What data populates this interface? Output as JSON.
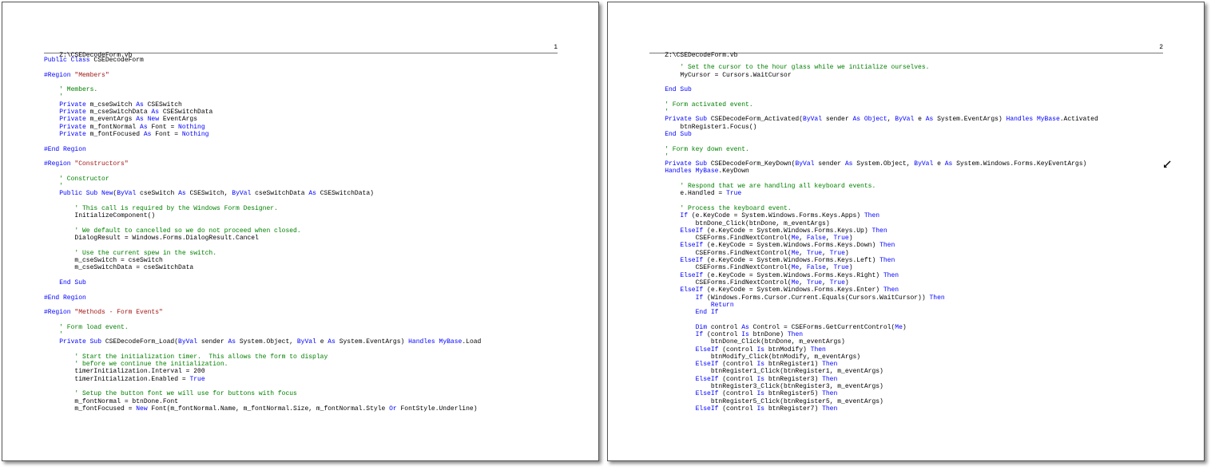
{
  "colors": {
    "keyword": "#0000ff",
    "comment": "#008000",
    "string": "#a31515",
    "text": "#000000"
  },
  "pages": [
    {
      "header_file": "Z:\\CSEDecodeForm.vb",
      "page_number": "1",
      "lines": [
        [
          [
            "k",
            "Public Class "
          ],
          [
            "t",
            "CSEDecodeForm"
          ]
        ],
        [],
        [
          [
            "k",
            "#Region "
          ],
          [
            "s",
            "\"Members\""
          ]
        ],
        [],
        [
          [
            "c",
            "    ' Members."
          ]
        ],
        [
          [
            "c",
            "    '"
          ]
        ],
        [
          [
            "k",
            "    Private "
          ],
          [
            "t",
            "m_cseSwitch "
          ],
          [
            "k",
            "As "
          ],
          [
            "t",
            "CSESwitch"
          ]
        ],
        [
          [
            "k",
            "    Private "
          ],
          [
            "t",
            "m_cseSwitchData "
          ],
          [
            "k",
            "As "
          ],
          [
            "t",
            "CSESwitchData"
          ]
        ],
        [
          [
            "k",
            "    Private "
          ],
          [
            "t",
            "m_eventArgs "
          ],
          [
            "k",
            "As New "
          ],
          [
            "t",
            "EventArgs"
          ]
        ],
        [
          [
            "k",
            "    Private "
          ],
          [
            "t",
            "m_fontNormal "
          ],
          [
            "k",
            "As "
          ],
          [
            "t",
            "Font = "
          ],
          [
            "k",
            "Nothing"
          ]
        ],
        [
          [
            "k",
            "    Private "
          ],
          [
            "t",
            "m_fontFocused "
          ],
          [
            "k",
            "As "
          ],
          [
            "t",
            "Font = "
          ],
          [
            "k",
            "Nothing"
          ]
        ],
        [],
        [
          [
            "k",
            "#End Region"
          ]
        ],
        [],
        [
          [
            "k",
            "#Region "
          ],
          [
            "s",
            "\"Constructors\""
          ]
        ],
        [],
        [
          [
            "c",
            "    ' Constructor"
          ]
        ],
        [
          [
            "c",
            "    '"
          ]
        ],
        [
          [
            "k",
            "    Public Sub New"
          ],
          [
            "t",
            "("
          ],
          [
            "k",
            "ByVal "
          ],
          [
            "t",
            "cseSwitch "
          ],
          [
            "k",
            "As "
          ],
          [
            "t",
            "CSESwitch, "
          ],
          [
            "k",
            "ByVal "
          ],
          [
            "t",
            "cseSwitchData "
          ],
          [
            "k",
            "As "
          ],
          [
            "t",
            "CSESwitchData)"
          ]
        ],
        [],
        [
          [
            "c",
            "        ' This call is required by the Windows Form Designer."
          ]
        ],
        [
          [
            "t",
            "        InitializeComponent()"
          ]
        ],
        [],
        [
          [
            "c",
            "        ' We default to cancelled so we do not proceed when closed."
          ]
        ],
        [
          [
            "t",
            "        DialogResult = Windows.Forms.DialogResult.Cancel"
          ]
        ],
        [],
        [
          [
            "c",
            "        ' Use the current spew in the switch."
          ]
        ],
        [
          [
            "t",
            "        m_cseSwitch = cseSwitch"
          ]
        ],
        [
          [
            "t",
            "        m_cseSwitchData = cseSwitchData"
          ]
        ],
        [],
        [
          [
            "k",
            "    End Sub"
          ]
        ],
        [],
        [
          [
            "k",
            "#End Region"
          ]
        ],
        [],
        [
          [
            "k",
            "#Region "
          ],
          [
            "s",
            "\"Methods - Form Events\""
          ]
        ],
        [],
        [
          [
            "c",
            "    ' Form load event."
          ]
        ],
        [
          [
            "c",
            "    '"
          ]
        ],
        [
          [
            "k",
            "    Private Sub "
          ],
          [
            "t",
            "CSEDecodeForm_Load("
          ],
          [
            "k",
            "ByVal "
          ],
          [
            "t",
            "sender "
          ],
          [
            "k",
            "As "
          ],
          [
            "t",
            "System.Object, "
          ],
          [
            "k",
            "ByVal "
          ],
          [
            "t",
            "e "
          ],
          [
            "k",
            "As "
          ],
          [
            "t",
            "System.EventArgs) "
          ],
          [
            "k",
            "Handles MyBase"
          ],
          [
            "t",
            ".Load"
          ]
        ],
        [],
        [
          [
            "c",
            "        ' Start the initialization timer.  This allows the form to display"
          ]
        ],
        [
          [
            "c",
            "        ' before we continue the initialization."
          ]
        ],
        [
          [
            "t",
            "        timerInitialization.Interval = 200"
          ]
        ],
        [
          [
            "t",
            "        timerInitialization.Enabled = "
          ],
          [
            "k",
            "True"
          ]
        ],
        [],
        [
          [
            "c",
            "        ' Setup the button font we will use for buttons with focus"
          ]
        ],
        [
          [
            "t",
            "        m_fontNormal = btnDone.Font"
          ]
        ],
        [
          [
            "t",
            "        m_fontFocused = "
          ],
          [
            "k",
            "New "
          ],
          [
            "t",
            "Font(m_fontNormal.Name, m_fontNormal.Size, m_fontNormal.Style "
          ],
          [
            "k",
            "Or "
          ],
          [
            "t",
            "FontStyle.Underline)"
          ]
        ]
      ]
    },
    {
      "header_file": "Z:\\CSEDecodeForm.vb",
      "page_number": "2",
      "lines": [
        [],
        [
          [
            "c",
            "        ' Set the cursor to the hour glass while we initialize ourselves."
          ]
        ],
        [
          [
            "t",
            "        MyCursor = Cursors.WaitCursor"
          ]
        ],
        [],
        [
          [
            "k",
            "    End Sub"
          ]
        ],
        [],
        [
          [
            "c",
            "    ' Form activated event."
          ]
        ],
        [
          [
            "c",
            "    '"
          ]
        ],
        [
          [
            "k",
            "    Private Sub "
          ],
          [
            "t",
            "CSEDecodeForm_Activated("
          ],
          [
            "k",
            "ByVal "
          ],
          [
            "t",
            "sender "
          ],
          [
            "k",
            "As Object"
          ],
          [
            "t",
            ", "
          ],
          [
            "k",
            "ByVal "
          ],
          [
            "t",
            "e "
          ],
          [
            "k",
            "As "
          ],
          [
            "t",
            "System.EventArgs) "
          ],
          [
            "k",
            "Handles MyBase"
          ],
          [
            "t",
            ".Activated"
          ]
        ],
        [
          [
            "t",
            "        btnRegister1.Focus()"
          ]
        ],
        [
          [
            "k",
            "    End Sub"
          ]
        ],
        [],
        [
          [
            "c",
            "    ' Form key down event."
          ]
        ],
        [
          [
            "c",
            "    '"
          ]
        ],
        [
          [
            "k",
            "    Private Sub "
          ],
          [
            "t",
            "CSEDecodeForm_KeyDown("
          ],
          [
            "k",
            "ByVal "
          ],
          [
            "t",
            "sender "
          ],
          [
            "k",
            "As "
          ],
          [
            "t",
            "System.Object, "
          ],
          [
            "k",
            "ByVal "
          ],
          [
            "t",
            "e "
          ],
          [
            "k",
            "As "
          ],
          [
            "t",
            "System.Windows.Forms.KeyEventArgs)"
          ]
        ],
        [
          [
            "k",
            "    Handles MyBase"
          ],
          [
            "t",
            ".KeyDown"
          ]
        ],
        [],
        [
          [
            "c",
            "        ' Respond that we are handling all keyboard events."
          ]
        ],
        [
          [
            "t",
            "        e.Handled = "
          ],
          [
            "k",
            "True"
          ]
        ],
        [],
        [
          [
            "c",
            "        ' Process the keyboard event."
          ]
        ],
        [
          [
            "k",
            "        If "
          ],
          [
            "t",
            "(e.KeyCode = System.Windows.Forms.Keys.Apps) "
          ],
          [
            "k",
            "Then"
          ]
        ],
        [
          [
            "t",
            "            btnDone_Click(btnDone, m_eventArgs)"
          ]
        ],
        [
          [
            "k",
            "        ElseIf "
          ],
          [
            "t",
            "(e.KeyCode = System.Windows.Forms.Keys.Up) "
          ],
          [
            "k",
            "Then"
          ]
        ],
        [
          [
            "t",
            "            CSEForms.FindNextControl("
          ],
          [
            "k",
            "Me"
          ],
          [
            "t",
            ", "
          ],
          [
            "k",
            "False"
          ],
          [
            "t",
            ", "
          ],
          [
            "k",
            "True"
          ],
          [
            "t",
            ")"
          ]
        ],
        [
          [
            "k",
            "        ElseIf "
          ],
          [
            "t",
            "(e.KeyCode = System.Windows.Forms.Keys.Down) "
          ],
          [
            "k",
            "Then"
          ]
        ],
        [
          [
            "t",
            "            CSEForms.FindNextControl("
          ],
          [
            "k",
            "Me"
          ],
          [
            "t",
            ", "
          ],
          [
            "k",
            "True"
          ],
          [
            "t",
            ", "
          ],
          [
            "k",
            "True"
          ],
          [
            "t",
            ")"
          ]
        ],
        [
          [
            "k",
            "        ElseIf "
          ],
          [
            "t",
            "(e.KeyCode = System.Windows.Forms.Keys.Left) "
          ],
          [
            "k",
            "Then"
          ]
        ],
        [
          [
            "t",
            "            CSEForms.FindNextControl("
          ],
          [
            "k",
            "Me"
          ],
          [
            "t",
            ", "
          ],
          [
            "k",
            "False"
          ],
          [
            "t",
            ", "
          ],
          [
            "k",
            "True"
          ],
          [
            "t",
            ")"
          ]
        ],
        [
          [
            "k",
            "        ElseIf "
          ],
          [
            "t",
            "(e.KeyCode = System.Windows.Forms.Keys.Right) "
          ],
          [
            "k",
            "Then"
          ]
        ],
        [
          [
            "t",
            "            CSEForms.FindNextControl("
          ],
          [
            "k",
            "Me"
          ],
          [
            "t",
            ", "
          ],
          [
            "k",
            "True"
          ],
          [
            "t",
            ", "
          ],
          [
            "k",
            "True"
          ],
          [
            "t",
            ")"
          ]
        ],
        [
          [
            "k",
            "        ElseIf "
          ],
          [
            "t",
            "(e.KeyCode = System.Windows.Forms.Keys.Enter) "
          ],
          [
            "k",
            "Then"
          ]
        ],
        [
          [
            "k",
            "            If "
          ],
          [
            "t",
            "(Windows.Forms.Cursor.Current.Equals(Cursors.WaitCursor)) "
          ],
          [
            "k",
            "Then"
          ]
        ],
        [
          [
            "k",
            "                Return"
          ]
        ],
        [
          [
            "k",
            "            End If"
          ]
        ],
        [],
        [
          [
            "k",
            "            Dim "
          ],
          [
            "t",
            "control "
          ],
          [
            "k",
            "As "
          ],
          [
            "t",
            "Control = CSEForms.GetCurrentControl("
          ],
          [
            "k",
            "Me"
          ],
          [
            "t",
            ")"
          ]
        ],
        [
          [
            "k",
            "            If "
          ],
          [
            "t",
            "(control "
          ],
          [
            "k",
            "Is "
          ],
          [
            "t",
            "btnDone) "
          ],
          [
            "k",
            "Then"
          ]
        ],
        [
          [
            "t",
            "                btnDone_Click(btnDone, m_eventArgs)"
          ]
        ],
        [
          [
            "k",
            "            ElseIf "
          ],
          [
            "t",
            "(control "
          ],
          [
            "k",
            "Is "
          ],
          [
            "t",
            "btnModify) "
          ],
          [
            "k",
            "Then"
          ]
        ],
        [
          [
            "t",
            "                btnModify_Click(btnModify, m_eventArgs)"
          ]
        ],
        [
          [
            "k",
            "            ElseIf "
          ],
          [
            "t",
            "(control "
          ],
          [
            "k",
            "Is "
          ],
          [
            "t",
            "btnRegister1) "
          ],
          [
            "k",
            "Then"
          ]
        ],
        [
          [
            "t",
            "                btnRegister1_Click(btnRegister1, m_eventArgs)"
          ]
        ],
        [
          [
            "k",
            "            ElseIf "
          ],
          [
            "t",
            "(control "
          ],
          [
            "k",
            "Is "
          ],
          [
            "t",
            "btnRegister3) "
          ],
          [
            "k",
            "Then"
          ]
        ],
        [
          [
            "t",
            "                btnRegister3_Click(btnRegister3, m_eventArgs)"
          ]
        ],
        [
          [
            "k",
            "            ElseIf "
          ],
          [
            "t",
            "(control "
          ],
          [
            "k",
            "Is "
          ],
          [
            "t",
            "btnRegister5) "
          ],
          [
            "k",
            "Then"
          ]
        ],
        [
          [
            "t",
            "                btnRegister5_Click(btnRegister5, m_eventArgs)"
          ]
        ],
        [
          [
            "k",
            "            ElseIf "
          ],
          [
            "t",
            "(control "
          ],
          [
            "k",
            "Is "
          ],
          [
            "t",
            "btnRegister7) "
          ],
          [
            "k",
            "Then"
          ]
        ]
      ]
    }
  ]
}
